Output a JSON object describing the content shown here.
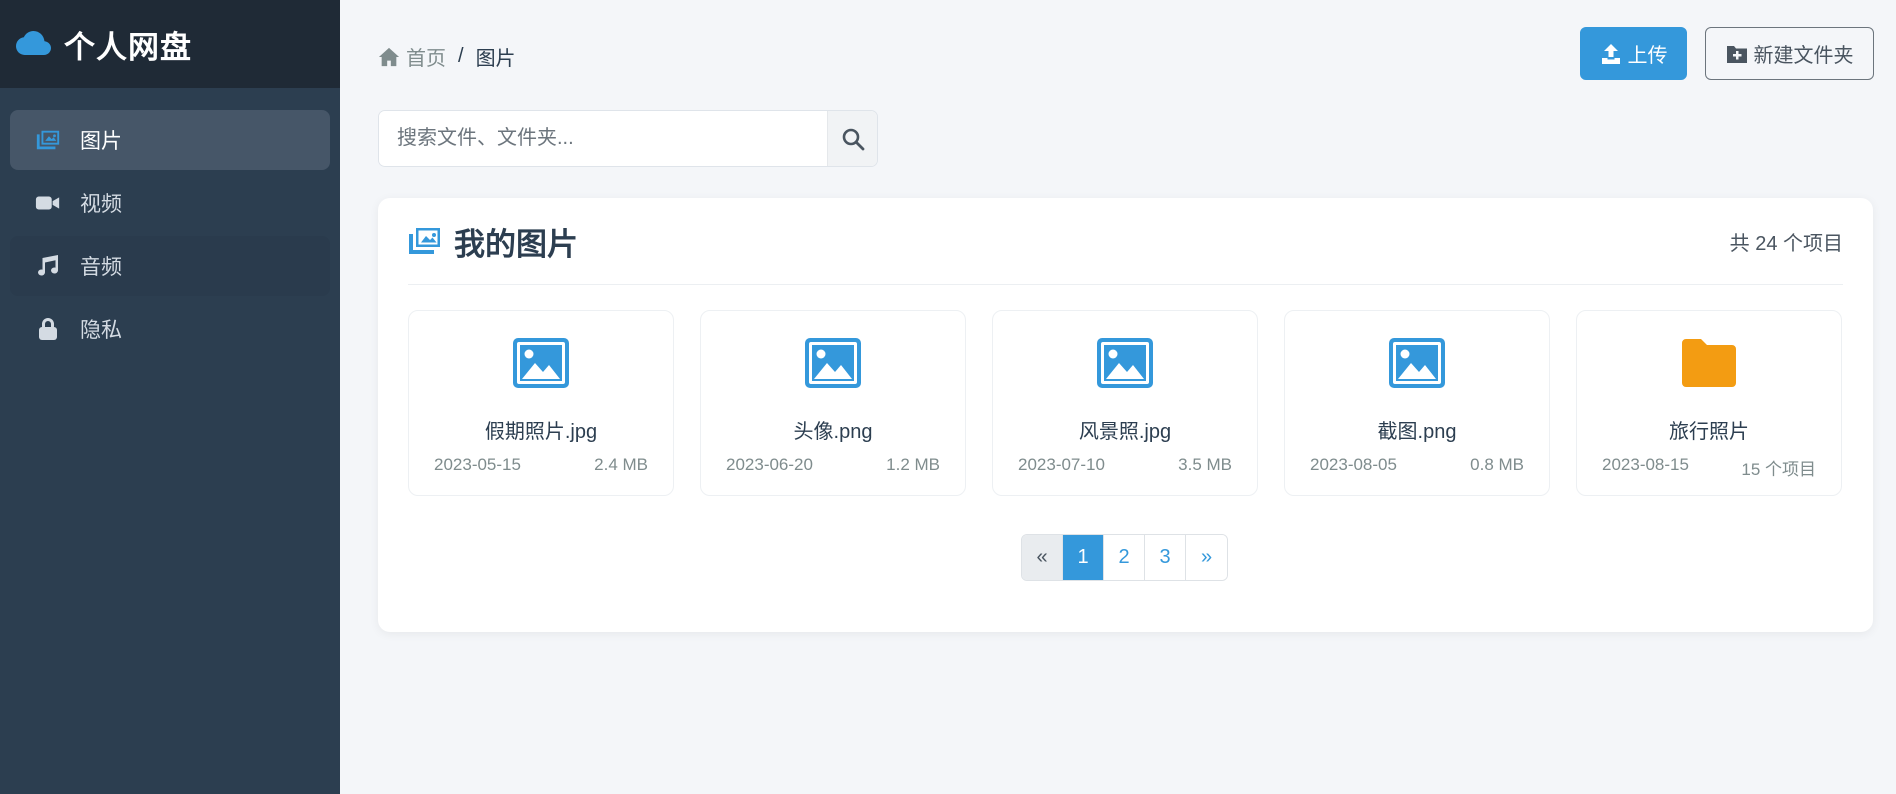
{
  "app": {
    "title": "个人网盘"
  },
  "sidebar": {
    "items": [
      {
        "label": "图片",
        "icon": "images-icon",
        "active": true
      },
      {
        "label": "视频",
        "icon": "video-icon",
        "active": false
      },
      {
        "label": "音频",
        "icon": "music-icon",
        "active": false
      },
      {
        "label": "隐私",
        "icon": "lock-icon",
        "active": false
      }
    ]
  },
  "breadcrumb": {
    "home": "首页",
    "separator": "/",
    "current": "图片"
  },
  "toolbar": {
    "upload_label": "上传",
    "new_folder_label": "新建文件夹"
  },
  "search": {
    "placeholder": "搜索文件、文件夹..."
  },
  "main": {
    "title": "我的图片",
    "item_count": "共 24 个项目",
    "files": [
      {
        "name": "假期照片.jpg",
        "date": "2023-05-15",
        "size": "2.4 MB",
        "type": "image"
      },
      {
        "name": "头像.png",
        "date": "2023-06-20",
        "size": "1.2 MB",
        "type": "image"
      },
      {
        "name": "风景照.jpg",
        "date": "2023-07-10",
        "size": "3.5 MB",
        "type": "image"
      },
      {
        "name": "截图.png",
        "date": "2023-08-05",
        "size": "0.8 MB",
        "type": "image"
      },
      {
        "name": "旅行照片",
        "date": "2023-08-15",
        "size": "15 个项目",
        "type": "folder"
      }
    ]
  },
  "pagination": {
    "prev": "«",
    "pages": [
      "1",
      "2",
      "3"
    ],
    "next": "»",
    "current": "1"
  },
  "colors": {
    "accent": "#3498db",
    "sidebar": "#2c3e50",
    "folder": "#f39c12"
  }
}
